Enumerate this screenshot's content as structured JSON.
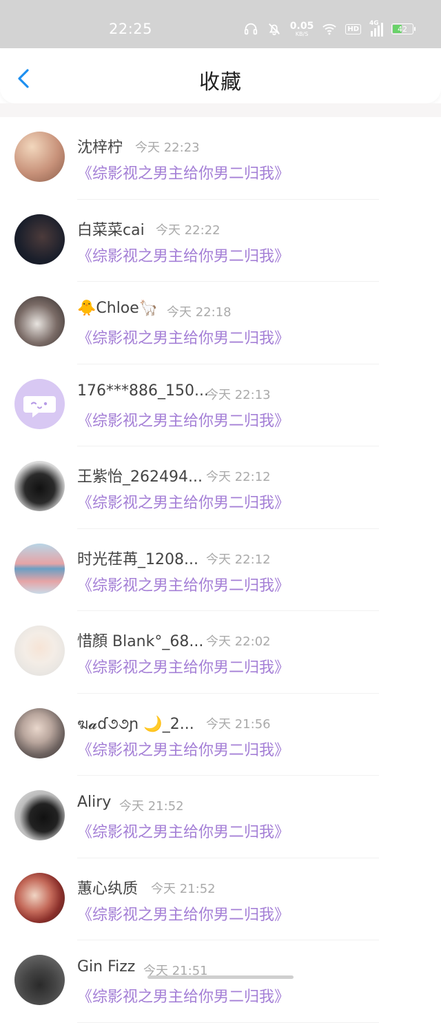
{
  "status_bar": {
    "time": "22:25",
    "net_speed": "0.05",
    "net_unit": "KB/S",
    "hd_label": "HD",
    "signal_label": "4G",
    "battery_level": "42",
    "icons": [
      "headphones-icon",
      "mute-icon",
      "wifi-icon",
      "signal-icon",
      "battery-icon"
    ]
  },
  "nav": {
    "title": "收藏",
    "back_icon": "chevron-left-icon"
  },
  "colors": {
    "accent_blue": "#1d8ff0",
    "book_purple": "#a47fd6",
    "status_bar_bg": "#d3d3d3"
  },
  "items": [
    {
      "name": "沈梓柠",
      "time": "今天 22:23",
      "book": "《综影视之男主给你男二归我》"
    },
    {
      "name": "白菜菜cai",
      "time": "今天 22:22",
      "book": "《综影视之男主给你男二归我》"
    },
    {
      "name": "🐥Chloe🦙",
      "time": "今天 22:18",
      "book": "《综影视之男主给你男二归我》"
    },
    {
      "name": "176***886_150...",
      "time": "今天 22:13",
      "book": "《综影视之男主给你男二归我》"
    },
    {
      "name": "王紫怡_262494...",
      "time": "今天 22:12",
      "book": "《综影视之男主给你男二归我》"
    },
    {
      "name": "时光荏苒_1208...",
      "time": "今天 22:12",
      "book": "《综影视之男主给你男二归我》"
    },
    {
      "name": "惜顏 Blank°_68...",
      "time": "今天 22:02",
      "book": "《综影视之男主给你男二归我》"
    },
    {
      "name": "ฆ𝓪ɗ૭૭ɲ 🌙_2...",
      "time": "今天 21:56",
      "book": "《综影视之男主给你男二归我》"
    },
    {
      "name": "Aliry",
      "time": "今天 21:52",
      "book": "《综影视之男主给你男二归我》"
    },
    {
      "name": "蕙心纨质",
      "time": "今天 21:52",
      "book": "《综影视之男主给你男二归我》"
    },
    {
      "name": "Gin Fizz",
      "time": "今天 21:51",
      "book": "《综影视之男主给你男二归我》"
    }
  ]
}
